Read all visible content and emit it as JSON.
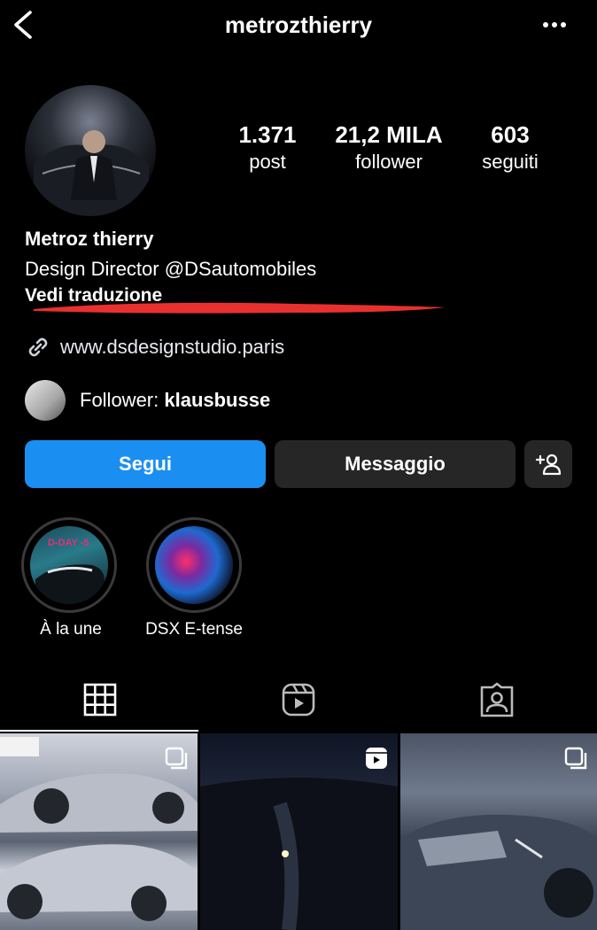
{
  "header": {
    "username": "metrozthierry"
  },
  "stats": [
    {
      "value": "1.371",
      "label": "post"
    },
    {
      "value": "21,2 MILA",
      "label": "follower"
    },
    {
      "value": "603",
      "label": "seguiti"
    }
  ],
  "profile": {
    "name": "Metroz thierry",
    "bio": "Design Director @DSautomobiles",
    "translate": "Vedi traduzione",
    "link": "www.dsdesignstudio.paris",
    "follower_prefix": "Follower: ",
    "follower_name": "klausbusse"
  },
  "actions": {
    "follow": "Segui",
    "message": "Messaggio"
  },
  "highlights": [
    {
      "label": "À la une",
      "thumb_text": "D-DAY -5"
    },
    {
      "label": "DSX E-tense"
    }
  ],
  "colors": {
    "accent": "#1b8ef2",
    "button_dark": "#262626",
    "redaction": "#e8312f"
  },
  "icons": {
    "back": "chevron-left-icon",
    "more": "more-horizontal-icon",
    "add_person": "add-person-icon",
    "link": "link-icon",
    "grid_tab": "grid-icon",
    "reels_tab": "reels-icon",
    "tagged_tab": "tagged-icon"
  }
}
